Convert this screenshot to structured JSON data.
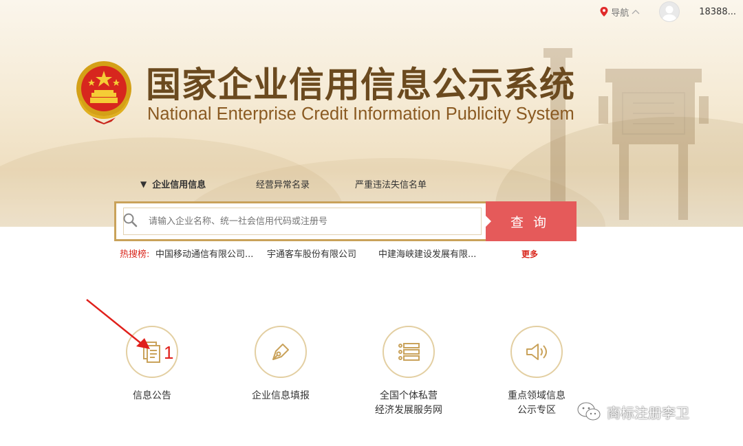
{
  "topbar": {
    "nav_label": "导航",
    "user_name": "18388..."
  },
  "header": {
    "title_cn": "国家企业信用信息公示系统",
    "title_en": "National Enterprise Credit Information Publicity System"
  },
  "search": {
    "tabs": [
      "企业信用信息",
      "经营异常名录",
      "严重违法失信名单"
    ],
    "active_tab_arrow": "▼",
    "placeholder": "请输入企业名称、统一社会信用代码或注册号",
    "button_label": "查询"
  },
  "hot_search": {
    "label": "热搜榜:",
    "items": [
      "中国移动通信有限公司...",
      "宇通客车股份有限公司",
      "中建海峡建设发展有限..."
    ],
    "more_label": "更多"
  },
  "services": [
    {
      "icon": "document-icon",
      "lines": [
        "信息公告"
      ]
    },
    {
      "icon": "pen-icon",
      "lines": [
        "企业信息填报"
      ]
    },
    {
      "icon": "list-icon",
      "lines": [
        "全国个体私营",
        "经济发展服务网"
      ]
    },
    {
      "icon": "speaker-icon",
      "lines": [
        "重点领域信息",
        "公示专区"
      ]
    }
  ],
  "annotation": {
    "number": "1"
  },
  "watermark": {
    "text": "商标注册李卫"
  },
  "colors": {
    "accent_red": "#e55a5a",
    "gold": "#c9a25a",
    "title_brown": "#6b4a1f",
    "hot_red": "#d9261c"
  }
}
